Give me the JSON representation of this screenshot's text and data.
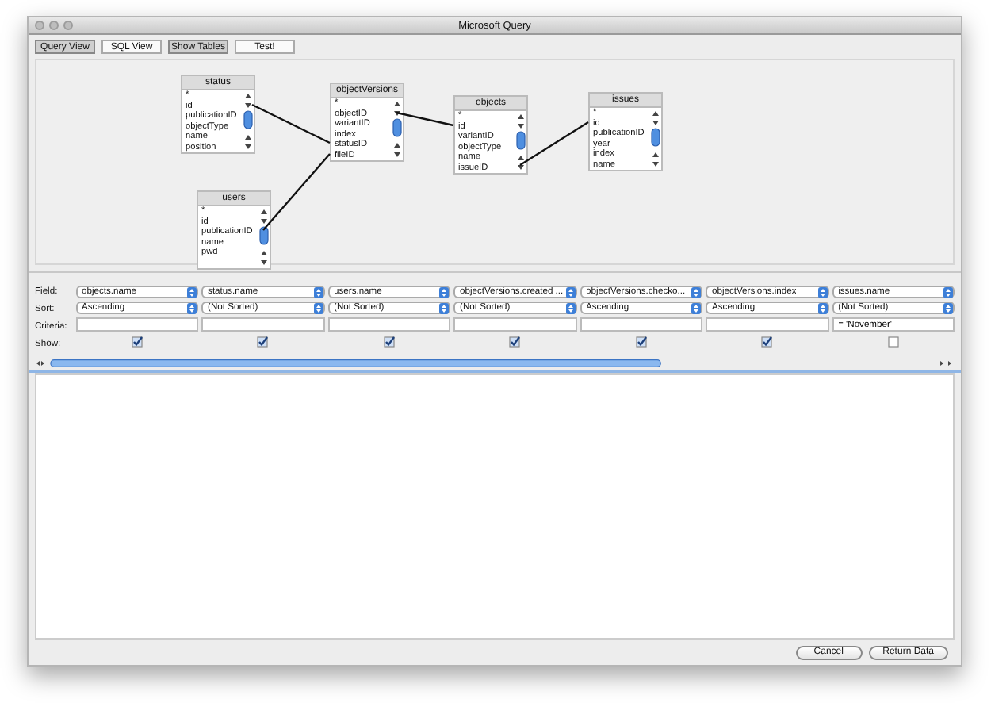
{
  "window": {
    "title": "Microsoft Query"
  },
  "toolbar": [
    {
      "label": "Query View",
      "selected": true
    },
    {
      "label": "SQL View",
      "selected": false
    },
    {
      "label": "Show Tables",
      "selected": true
    },
    {
      "label": "Test!",
      "selected": false
    }
  ],
  "tables": [
    {
      "name": "status",
      "fields": [
        "*",
        "id",
        "publicationID",
        "objectType",
        "name",
        "position"
      ]
    },
    {
      "name": "objectVersions",
      "fields": [
        "*",
        "objectID",
        "variantID",
        "index",
        "statusID",
        "fileID"
      ]
    },
    {
      "name": "objects",
      "fields": [
        "*",
        "id",
        "variantID",
        "objectType",
        "name",
        "issueID"
      ]
    },
    {
      "name": "issues",
      "fields": [
        "*",
        "id",
        "publicationID",
        "year",
        "index",
        "name"
      ]
    },
    {
      "name": "users",
      "fields": [
        "*",
        "id",
        "publicationID",
        "name",
        "pwd"
      ]
    }
  ],
  "criteria_grid": {
    "row_labels": [
      "Field:",
      "Sort:",
      "Criteria:",
      "Show:"
    ],
    "columns": [
      {
        "field": "objects.name",
        "sort": "Ascending",
        "show": true
      },
      {
        "field": "status.name",
        "sort": "(Not Sorted)",
        "show": true
      },
      {
        "field": "users.name",
        "sort": "(Not Sorted)",
        "show": true
      },
      {
        "field": "objectVersions.created ...",
        "sort": "(Not Sorted)",
        "show": true
      },
      {
        "field": "objectVersions.checko...",
        "sort": "Ascending",
        "show": true
      },
      {
        "field": "objectVersions.index",
        "sort": "Ascending",
        "show": true
      },
      {
        "field": "issues.name",
        "sort": "(Not Sorted)",
        "criteria": "= 'November'",
        "show": false
      }
    ]
  },
  "buttons": [
    "Cancel",
    "Return Data"
  ]
}
